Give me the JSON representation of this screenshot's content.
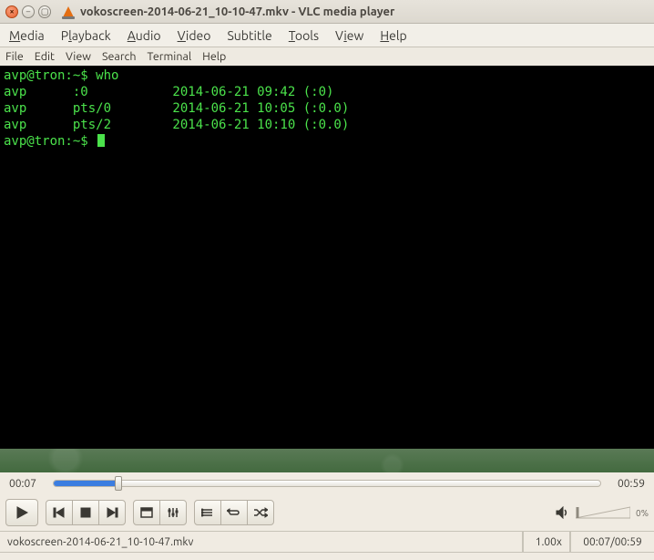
{
  "window": {
    "title": "vokoscreen-2014-06-21_10-10-47.mkv - VLC media player",
    "buttons": {
      "close": "×",
      "minimize": "–",
      "maximize": "▢"
    }
  },
  "vlc_menu": {
    "media": {
      "label": "Media",
      "accel": "M"
    },
    "playback": {
      "label": "Playback",
      "accel": "l"
    },
    "audio": {
      "label": "Audio",
      "accel": "A"
    },
    "video": {
      "label": "Video",
      "accel": "V"
    },
    "subtitle": {
      "label": "Subtitle",
      "accel": ""
    },
    "tools": {
      "label": "Tools",
      "accel": "T"
    },
    "view": {
      "label": "View",
      "accel": "i"
    },
    "help": {
      "label": "Help",
      "accel": "H"
    }
  },
  "terminal_menu": [
    "File",
    "Edit",
    "View",
    "Search",
    "Terminal",
    "Help"
  ],
  "terminal": {
    "prompt1": "avp@tron:~$ who",
    "rows": [
      "avp      :0           2014-06-21 09:42 (:0)",
      "avp      pts/0        2014-06-21 10:05 (:0.0)",
      "avp      pts/2        2014-06-21 10:10 (:0.0)"
    ],
    "prompt2": "avp@tron:~$ "
  },
  "playback": {
    "elapsed": "00:07",
    "duration": "00:59",
    "progress_pct": 11.9,
    "speed": "1.00x",
    "volume_pct": 0,
    "volume_label": "0%"
  },
  "status": {
    "file": "vokoscreen-2014-06-21_10-10-47.mkv",
    "time": "00:07/00:59"
  },
  "controls": {
    "play": "Play",
    "prev": "Previous",
    "stop": "Stop",
    "next": "Next",
    "fullscreen": "Fullscreen",
    "ext_settings": "Extended settings",
    "playlist": "Playlist",
    "loop": "Loop",
    "shuffle": "Shuffle",
    "mute": "Mute"
  }
}
